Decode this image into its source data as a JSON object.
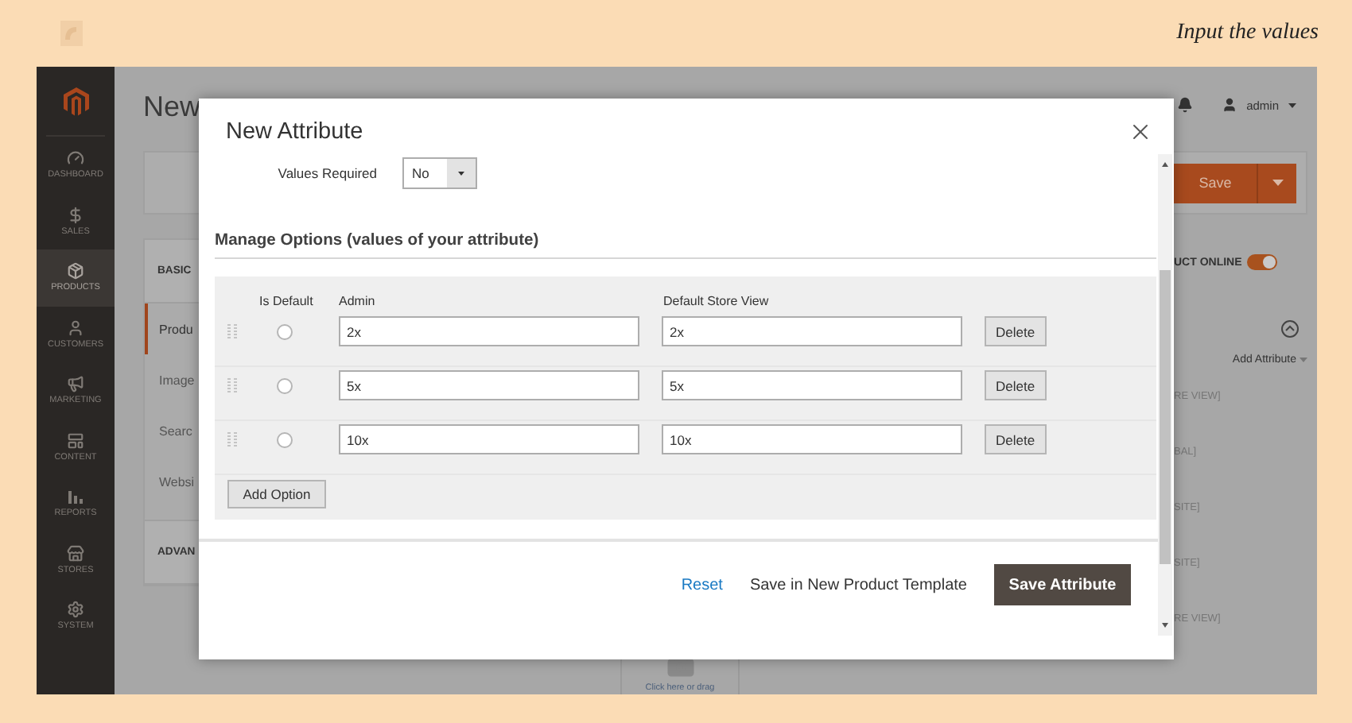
{
  "caption": "Input the values",
  "sidebar": {
    "items": [
      {
        "label": "DASHBOARD",
        "selected": false
      },
      {
        "label": "SALES",
        "selected": false
      },
      {
        "label": "PRODUCTS",
        "selected": true
      },
      {
        "label": "CUSTOMERS",
        "selected": false
      },
      {
        "label": "MARKETING",
        "selected": false
      },
      {
        "label": "CONTENT",
        "selected": false
      },
      {
        "label": "REPORTS",
        "selected": false
      },
      {
        "label": "STORES",
        "selected": false
      },
      {
        "label": "SYSTEM",
        "selected": false
      }
    ]
  },
  "page": {
    "title": "New",
    "user": "admin",
    "save_button": "Save",
    "tabs": [
      {
        "label": "BASIC",
        "kind": "heading",
        "selected": false
      },
      {
        "label": "Produ",
        "kind": "item",
        "selected": true
      },
      {
        "label": "Image",
        "kind": "item",
        "selected": false
      },
      {
        "label": "Searc",
        "kind": "item",
        "selected": false
      },
      {
        "label": "Websi",
        "kind": "item",
        "selected": false
      },
      {
        "label": "ADVAN",
        "kind": "heading",
        "selected": false
      }
    ],
    "status_label": "UCT ONLINE",
    "product_online": true,
    "add_attribute": "Add Attribute",
    "scope_labels": [
      "RE VIEW]",
      "BAL]",
      "SITE]",
      "SITE]",
      "RE VIEW]"
    ],
    "upload_hint": "Click here or drag"
  },
  "dialog": {
    "title": "New Attribute",
    "values_required": {
      "label": "Values Required",
      "value": "No"
    },
    "section_title": "Manage Options (values of your attribute)",
    "columns": [
      "Is Default",
      "Admin",
      "Default Store View"
    ],
    "options": [
      {
        "is_default": false,
        "admin": "2x",
        "store_view": "2x",
        "delete": "Delete"
      },
      {
        "is_default": false,
        "admin": "5x",
        "store_view": "5x",
        "delete": "Delete"
      },
      {
        "is_default": false,
        "admin": "10x",
        "store_view": "10x",
        "delete": "Delete"
      }
    ],
    "add_option": "Add Option",
    "footer": {
      "reset": "Reset",
      "save_template": "Save in New Product Template",
      "save": "Save Attribute"
    }
  }
}
